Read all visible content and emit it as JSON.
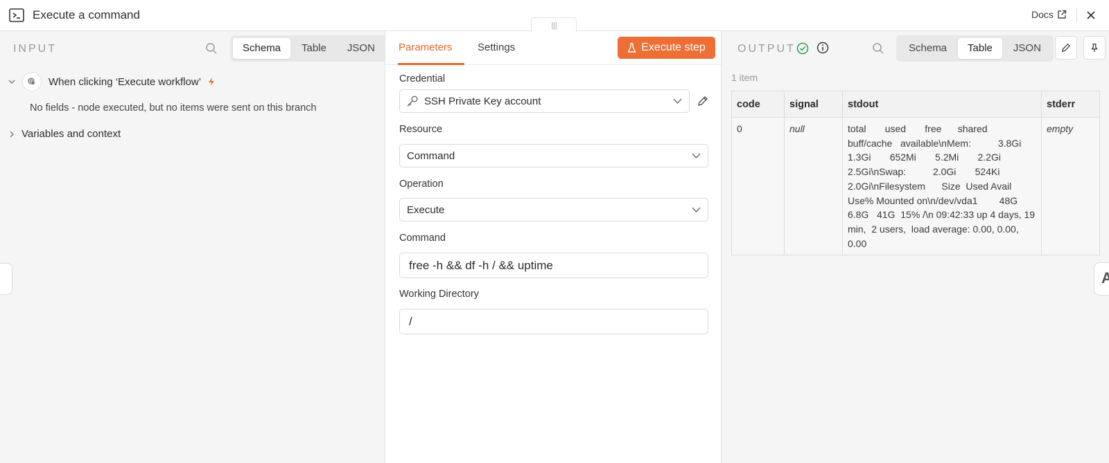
{
  "header": {
    "title": "Execute a command",
    "docs_label": "Docs"
  },
  "input_panel": {
    "label": "INPUT",
    "view_options": [
      "Schema",
      "Table",
      "JSON"
    ],
    "active_view": "Schema",
    "trigger_node": "When clicking ‘Execute workflow’",
    "no_fields_message": "No fields - node executed, but no items were sent on this branch",
    "variables_label": "Variables and context"
  },
  "parameters_panel": {
    "tabs": [
      "Parameters",
      "Settings"
    ],
    "active_tab": "Parameters",
    "execute_label": "Execute step",
    "fields": {
      "credential": {
        "label": "Credential",
        "value": "SSH Private Key account"
      },
      "resource": {
        "label": "Resource",
        "value": "Command"
      },
      "operation": {
        "label": "Operation",
        "value": "Execute"
      },
      "command": {
        "label": "Command",
        "value": "free -h && df -h / && uptime"
      },
      "working_directory": {
        "label": "Working Directory",
        "value": "/"
      }
    }
  },
  "output_panel": {
    "label": "OUTPUT",
    "view_options": [
      "Schema",
      "Table",
      "JSON"
    ],
    "active_view": "Table",
    "item_count": "1 item",
    "columns": [
      "code",
      "signal",
      "stdout",
      "stderr"
    ],
    "row": {
      "code": "0",
      "signal": "null",
      "stdout": "total       used       free      shared     buff/cache   available\\nMem:          3.8Gi       1.3Gi       652Mi       5.2Mi       2.2Gi       2.5Gi\\nSwap:          2.0Gi       524Ki       2.0Gi\\nFilesystem      Size  Used Avail Use% Mounted on\\n/dev/vda1        48G  6.8G   41G  15% /\\n 09:42:33 up 4 days, 19 min,  2 users,  load average: 0.00, 0.00, 0.00",
      "stderr": "empty"
    }
  },
  "colors": {
    "accent": "#ee6f36",
    "success": "#2e9d4b",
    "null_value": "#d33a3a"
  }
}
